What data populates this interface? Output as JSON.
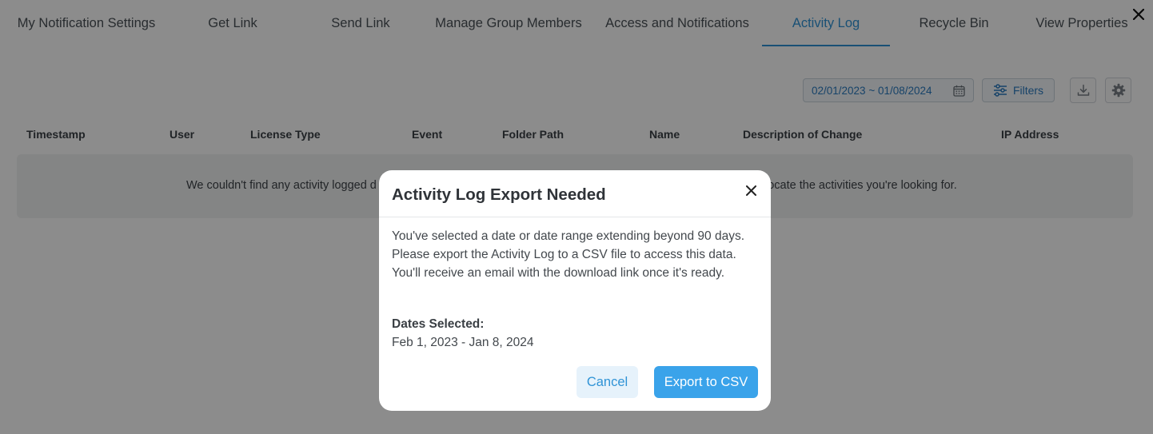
{
  "tabs": [
    {
      "label": "My Notification Settings"
    },
    {
      "label": "Get Link"
    },
    {
      "label": "Send Link"
    },
    {
      "label": "Manage Group Members"
    },
    {
      "label": "Access and Notifications"
    },
    {
      "label": "Activity Log",
      "active": true
    },
    {
      "label": "Recycle Bin"
    },
    {
      "label": "View Properties"
    }
  ],
  "toolbar": {
    "date_range": "02/01/2023 ~ 01/08/2024",
    "filters_label": "Filters"
  },
  "table": {
    "columns": [
      "Timestamp",
      "User",
      "License Type",
      "Event",
      "Folder Path",
      "Name",
      "Description of Change",
      "IP Address"
    ],
    "empty_text_left": "We couldn't find any activity logged d",
    "empty_text_right": "locate the activities you're looking for."
  },
  "modal": {
    "title": "Activity Log Export Needed",
    "body": "You've selected a date or date range extending beyond 90 days. Please export the Activity Log to a CSV file to access this data. You'll receive an email with the download link once it's ready.",
    "dates_label": "Dates Selected:",
    "dates_value": "Feb 1, 2023 - Jan 8, 2024",
    "cancel_label": "Cancel",
    "export_label": "Export to CSV"
  },
  "colors": {
    "accent": "#2f93d6",
    "primary_button": "#3aa3ea",
    "overlay": "rgba(0,0,0,0.45)"
  },
  "icons": [
    "close-icon",
    "calendar-icon",
    "filters-icon",
    "download-icon",
    "gear-icon"
  ]
}
